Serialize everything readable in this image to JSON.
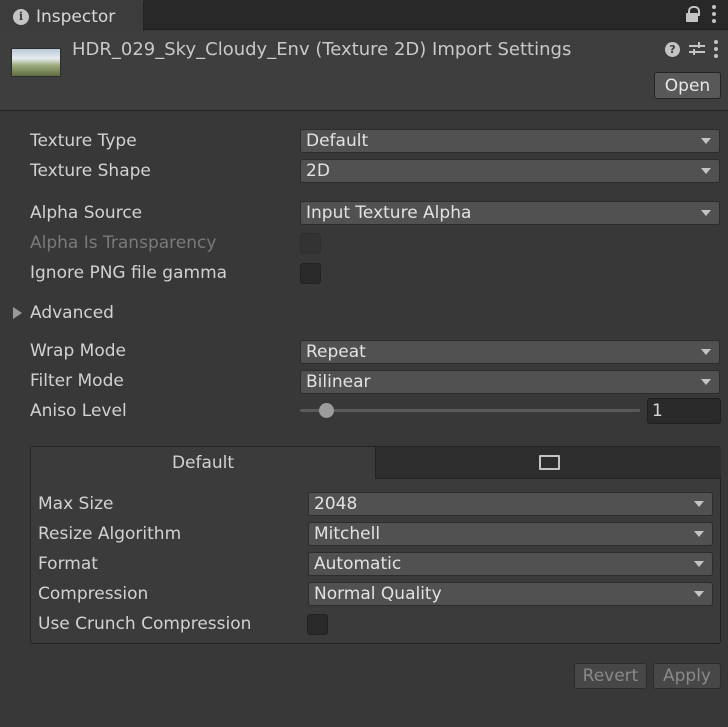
{
  "tab": {
    "label": "Inspector"
  },
  "header": {
    "title": "HDR_029_Sky_Cloudy_Env (Texture 2D) Import Settings",
    "open_label": "Open"
  },
  "fields": {
    "texture_type": {
      "label": "Texture Type",
      "value": "Default"
    },
    "texture_shape": {
      "label": "Texture Shape",
      "value": "2D"
    },
    "alpha_source": {
      "label": "Alpha Source",
      "value": "Input Texture Alpha"
    },
    "alpha_is_transparency": {
      "label": "Alpha Is Transparency",
      "checked": false,
      "disabled": true
    },
    "ignore_png_gamma": {
      "label": "Ignore PNG file gamma",
      "checked": false
    },
    "advanced": {
      "label": "Advanced",
      "expanded": false
    },
    "wrap_mode": {
      "label": "Wrap Mode",
      "value": "Repeat"
    },
    "filter_mode": {
      "label": "Filter Mode",
      "value": "Bilinear"
    },
    "aniso_level": {
      "label": "Aniso Level",
      "value": "1"
    }
  },
  "platform": {
    "tabs": [
      {
        "label": "Default",
        "selected": true
      },
      {
        "label": "",
        "icon": "monitor-icon",
        "selected": false
      }
    ],
    "max_size": {
      "label": "Max Size",
      "value": "2048"
    },
    "resize_algorithm": {
      "label": "Resize Algorithm",
      "value": "Mitchell"
    },
    "format": {
      "label": "Format",
      "value": "Automatic"
    },
    "compression": {
      "label": "Compression",
      "value": "Normal Quality"
    },
    "use_crunch": {
      "label": "Use Crunch Compression",
      "checked": false
    }
  },
  "footer": {
    "revert_label": "Revert",
    "apply_label": "Apply"
  },
  "colors": {
    "background": "#383838",
    "header": "#3e3e3e",
    "field": "#515151",
    "text": "#d2d2d2"
  }
}
